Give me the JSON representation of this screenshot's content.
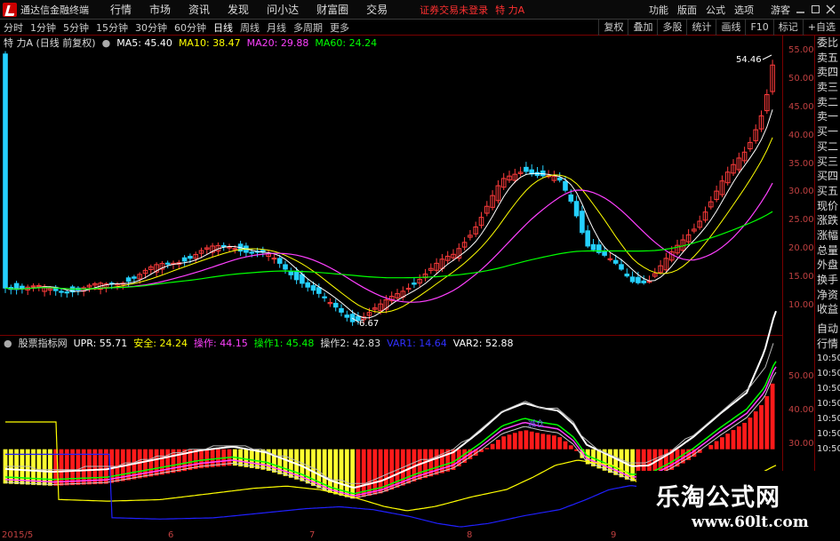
{
  "app": {
    "title": "通达信金融终端",
    "warning": "证券交易未登录",
    "stock": "特 力A",
    "guest": "游客"
  },
  "menu": [
    "行情",
    "市场",
    "资讯",
    "发现",
    "问小达",
    "财富圈",
    "交易"
  ],
  "right_menu": [
    "功能",
    "版面",
    "公式",
    "选项"
  ],
  "toolbar": {
    "timeframes": [
      "分时",
      "1分钟",
      "5分钟",
      "15分钟",
      "30分钟",
      "60分钟",
      "日线",
      "周线",
      "月线",
      "多周期",
      "更多"
    ],
    "active": "日线",
    "buttons": [
      "复权",
      "叠加",
      "多股",
      "统计",
      "画线",
      "F10",
      "标记",
      "+自选"
    ]
  },
  "main_info": {
    "name": "特 力A (日线 前复权)",
    "ma5": "MA5: 45.40",
    "ma10": "MA10: 38.47",
    "ma20": "MA20: 29.88",
    "ma60": "MA60: 24.24"
  },
  "sub_info": {
    "name": "股票指标网",
    "upr": "UPR: 55.71",
    "safe": "安全: 24.24",
    "op": "操作: 44.15",
    "op1": "操作1: 45.48",
    "op2": "操作2: 42.83",
    "var1": "VAR1: 14.64",
    "var2": "VAR2: 52.88"
  },
  "annotations": {
    "high": "54.46",
    "low": "6.67",
    "sell": "减仓"
  },
  "y_axis_main": [
    "55.00",
    "50.00",
    "45.00",
    "40.00",
    "35.00",
    "30.00",
    "25.00",
    "20.00",
    "15.00",
    "10.00"
  ],
  "y_axis_sub": [
    "50.00",
    "40.00",
    "30.00"
  ],
  "x_axis": [
    "2015/5",
    "6",
    "7",
    "8",
    "9"
  ],
  "side_panel": [
    "委比",
    "卖五",
    "卖四",
    "卖三",
    "卖二",
    "卖一",
    "买一",
    "买二",
    "买三",
    "买四",
    "买五",
    "现价",
    "涨跌",
    "涨幅",
    "总量",
    "外盘",
    "换手",
    "净资",
    "收益"
  ],
  "side_panel2": [
    "自动",
    "行情",
    "10:50",
    "10:50",
    "10:50",
    "10:50",
    "10:50",
    "10:50",
    "10:50",
    "10:50"
  ],
  "watermark": {
    "cn": "乐淘公式网",
    "url": "www.60lt.com"
  },
  "colors": {
    "up": "#ff3b3b",
    "down": "#25d0ff",
    "ma5": "#ffffff",
    "ma10": "#ffff00",
    "ma20": "#ff40ff",
    "ma60": "#00ff00",
    "border": "#7a0000"
  }
}
